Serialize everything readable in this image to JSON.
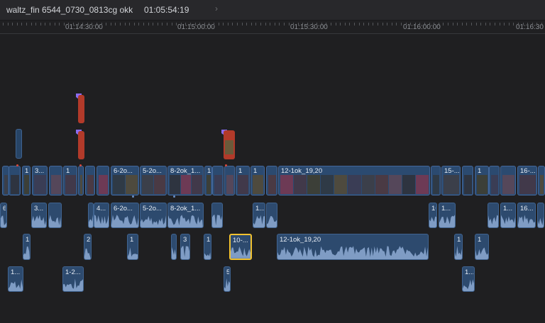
{
  "header": {
    "project_name": "waltz_fin 6544_0730_0813cg okk",
    "timecode": "01:05:54:19"
  },
  "ruler": {
    "labels": [
      "01:14:30:00",
      "01:15:00:00",
      "01:15:30:00",
      "01:16:00:00",
      "01:16:30"
    ]
  },
  "primary_clips": [
    "1",
    "1",
    "3...",
    "1",
    "6-2o...",
    "5-2o...",
    "8-2ok_1...",
    "1",
    "1",
    "1",
    "12-1ok_19,20",
    "15-...",
    "1",
    "16-..."
  ],
  "audio_row1": [
    "6",
    "3...",
    "4...",
    "6-2o...",
    "5-2o...",
    "8-2ok_1...",
    "1...",
    "16",
    "1...",
    "1...",
    "16..."
  ],
  "audio_row2": [
    "1",
    "2",
    "1",
    "3",
    "1",
    "10-...",
    "12-1ok_19,20",
    "1",
    "1"
  ],
  "audio_row3": [
    "1...",
    "1-2...",
    "5",
    "1..."
  ],
  "colors": {
    "clip_fill": "#2d4a6e",
    "selection": "#f2c230",
    "marker": "#8a6cf0",
    "connected_red": "#b23a2a"
  }
}
